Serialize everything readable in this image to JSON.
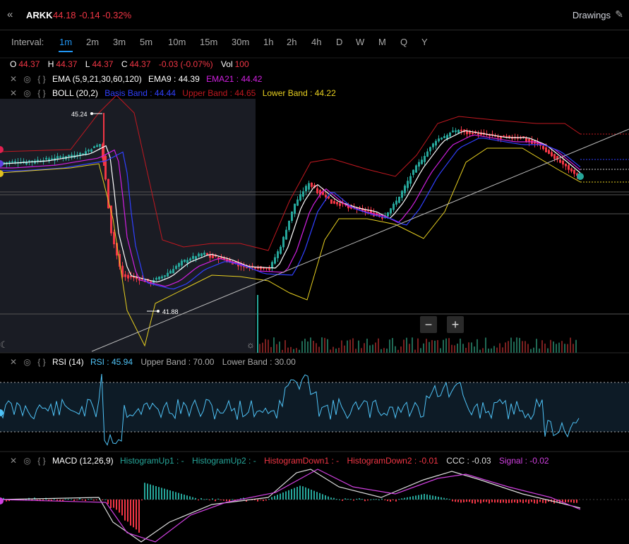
{
  "header": {
    "collapse_icon": "double-chevron-left-icon",
    "symbol": "ARKK",
    "last": "44.18",
    "change": "-0.14",
    "change_pct": "-0.32%",
    "drawings_label": "Drawings",
    "drawings_icon": "pencil-icon"
  },
  "intervals": {
    "label": "Interval:",
    "items": [
      "1m",
      "2m",
      "3m",
      "5m",
      "10m",
      "15m",
      "30m",
      "1h",
      "2h",
      "4h",
      "D",
      "W",
      "M",
      "Q",
      "Y"
    ],
    "active": "1m"
  },
  "ohlc": {
    "o_label": "O",
    "o": "44.37",
    "h_label": "H",
    "h": "44.37",
    "l_label": "L",
    "l": "44.37",
    "c_label": "C",
    "c": "44.37",
    "chg": "-0.03 (-0.07%)",
    "vol_label": "Vol",
    "vol": "100"
  },
  "ema": {
    "name": "EMA (5,9,21,30,60,120)",
    "ema9": "EMA9 : 44.39",
    "ema21": "EMA21 : 44.42"
  },
  "boll": {
    "name": "BOLL (20,2)",
    "basis": "Basis Band : 44.44",
    "upper": "Upper Band : 44.65",
    "lower": "Lower Band : 44.22"
  },
  "price_labels": {
    "high": "45.24",
    "low": "41.88"
  },
  "zoom": {
    "minus": "−",
    "plus": "+"
  },
  "rsi": {
    "name": "RSI (14)",
    "value": "RSI : 45.94",
    "upper": "Upper Band : 70.00",
    "lower": "Lower Band : 30.00"
  },
  "macd": {
    "name": "MACD (12,26,9)",
    "hu1": "HistogramUp1 : -",
    "hu2": "HistogramUp2 : -",
    "hd1": "HistogramDown1 : -",
    "hd2": "HistogramDown2 : -0.01",
    "ccc": "CCC : -0.03",
    "signal": "Signal : -0.02"
  },
  "colors": {
    "up": "#26a69a",
    "down": "#f23645",
    "accent": "#2196f3",
    "ema9": "#ffffff",
    "ema21": "#d020e0",
    "ema_blue": "#3040ff",
    "boll_upper": "#c01820",
    "boll_lower": "#e8d020",
    "rsi_line": "#4fc3f7",
    "macd_signal": "#d040e0"
  }
}
